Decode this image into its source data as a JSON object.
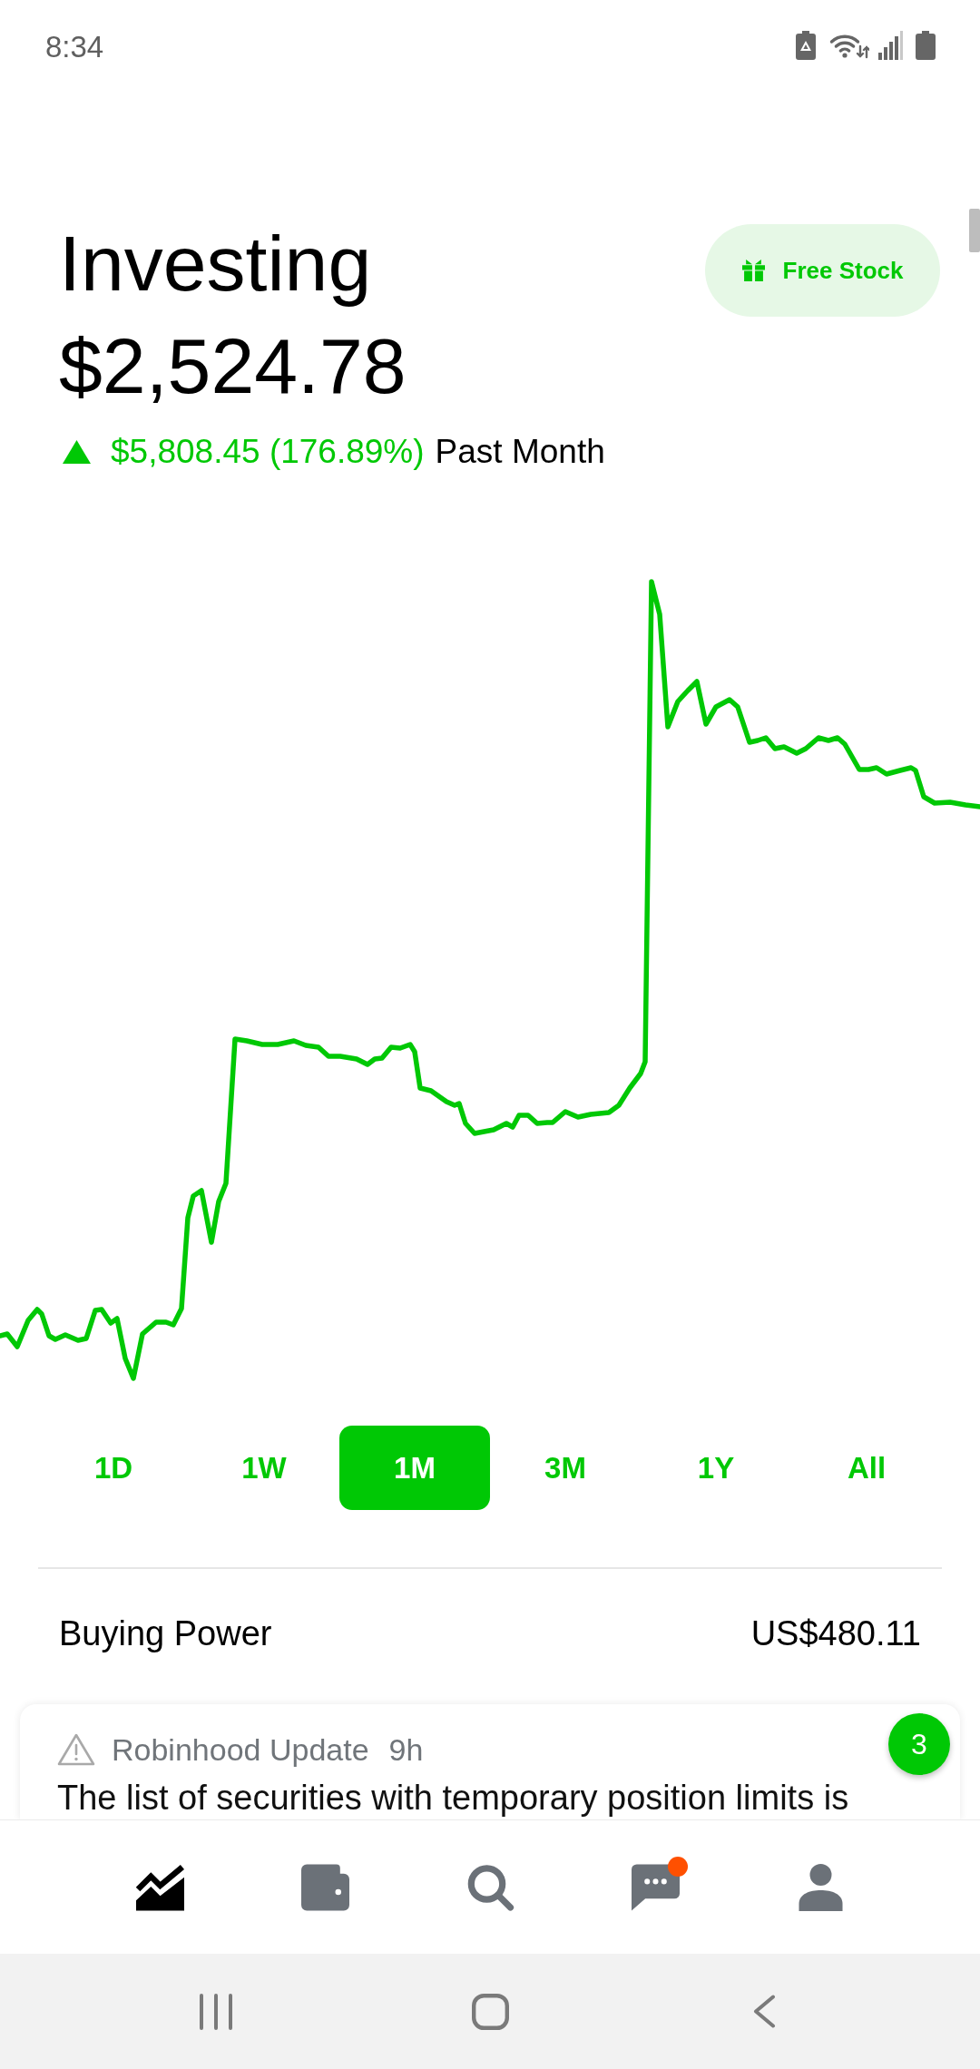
{
  "status_bar": {
    "time": "8:34"
  },
  "header": {
    "title": "Investing",
    "portfolio_value": "$2,524.78",
    "change": {
      "gain": true,
      "amount": "$5,808.45 (176.89%)",
      "period": "Past Month"
    },
    "promo_button": {
      "label": "Free Stock"
    }
  },
  "ranges": [
    {
      "label": "1D",
      "selected": false
    },
    {
      "label": "1W",
      "selected": false
    },
    {
      "label": "1M",
      "selected": true
    },
    {
      "label": "3M",
      "selected": false
    },
    {
      "label": "1Y",
      "selected": false
    },
    {
      "label": "All",
      "selected": false
    }
  ],
  "buying_power": {
    "label": "Buying Power",
    "value": "US$480.11"
  },
  "notification_card": {
    "source": "Robinhood Update",
    "age": "9h",
    "body": "The list of securities with temporary position limits is",
    "badge": "3"
  },
  "bottom_nav": [
    {
      "kind": "chart",
      "selected": true,
      "unread": false
    },
    {
      "kind": "wallet",
      "selected": false,
      "unread": false
    },
    {
      "kind": "search",
      "selected": false,
      "unread": false
    },
    {
      "kind": "messages",
      "selected": false,
      "unread": true
    },
    {
      "kind": "account",
      "selected": false,
      "unread": false
    }
  ]
}
